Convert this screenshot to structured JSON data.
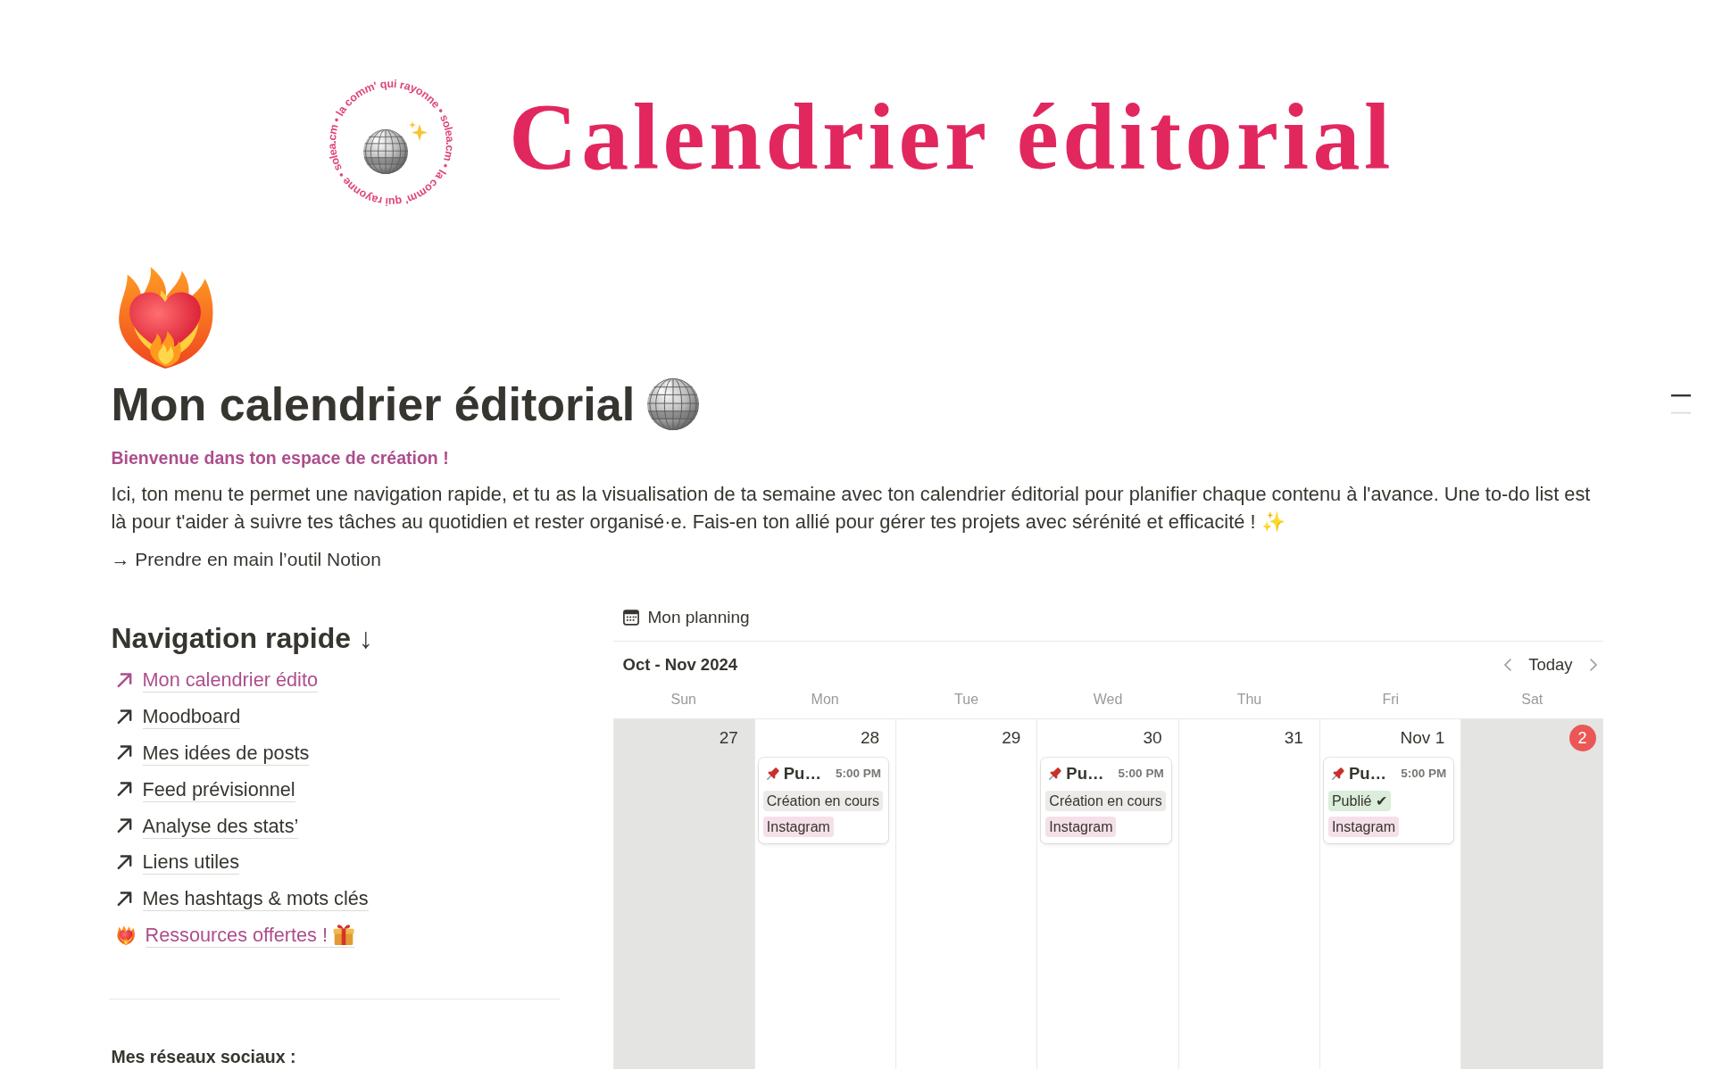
{
  "banner": {
    "logo_ring": [
      "la comm' qui rayonne •",
      "solea.cm •",
      "la comm' qui rayonne •",
      "solea.cm •"
    ],
    "title": "Calendrier éditorial"
  },
  "page": {
    "title": "Mon calendrier éditorial",
    "subtitle": "Bienvenue dans ton espace de création !",
    "intro": "Ici, ton menu te permet une navigation rapide, et tu as la visualisation de ta semaine avec ton calendrier éditorial pour planifier chaque contenu à l'avance. Une to-do list est là pour t'aider à suivre tes tâches au quotidien et rester organisé·e. Fais-en ton allié pour gérer tes projets avec sérénité et efficacité !",
    "intro_emoji": "✨",
    "guide": "→ Prendre en main l’outil Notion"
  },
  "navigation": {
    "heading": "Navigation rapide ↓",
    "items": [
      {
        "label": "Mon calendrier édito",
        "kind": "arrow",
        "color": "#ad4e8c"
      },
      {
        "label": "Moodboard",
        "kind": "arrow",
        "color": "#37352f"
      },
      {
        "label": "Mes idées de posts",
        "kind": "arrow",
        "color": "#37352f"
      },
      {
        "label": "Feed prévisionnel",
        "kind": "arrow",
        "color": "#37352f"
      },
      {
        "label": "Analyse des stats’",
        "kind": "arrow",
        "color": "#37352f"
      },
      {
        "label": "Liens utiles",
        "kind": "arrow",
        "color": "#37352f"
      },
      {
        "label": "Mes hashtags & mots clés",
        "kind": "arrow",
        "color": "#37352f"
      },
      {
        "label": "Ressources offertes !",
        "kind": "resource",
        "color": "#ad4e8c"
      }
    ]
  },
  "socials": {
    "heading": "Mes réseaux sociaux :"
  },
  "calendar": {
    "title": "Mon planning",
    "range": "Oct - Nov 2024",
    "today_button": "Today",
    "weekdays": [
      "Sun",
      "Mon",
      "Tue",
      "Wed",
      "Thu",
      "Fri",
      "Sat"
    ],
    "days": [
      {
        "label": "27",
        "weekend": true,
        "today": false
      },
      {
        "label": "28",
        "weekend": false,
        "today": false,
        "events": [
          {
            "title": "Pu…",
            "time": "5:00 PM",
            "tags": [
              {
                "label": "Création en cours",
                "color": "#ecebe9"
              },
              {
                "label": "Instagram",
                "color": "#f5e0ea"
              }
            ]
          }
        ]
      },
      {
        "label": "29",
        "weekend": false,
        "today": false
      },
      {
        "label": "30",
        "weekend": false,
        "today": false,
        "events": [
          {
            "title": "Pu…",
            "time": "5:00 PM",
            "tags": [
              {
                "label": "Création en cours",
                "color": "#ecebe9"
              },
              {
                "label": "Instagram",
                "color": "#f5e0ea"
              }
            ]
          }
        ]
      },
      {
        "label": "31",
        "weekend": false,
        "today": false
      },
      {
        "label": "Nov 1",
        "weekend": false,
        "today": false,
        "events": [
          {
            "title": "Pu…",
            "time": "5:00 PM",
            "tags": [
              {
                "label": "Publié ✔",
                "color": "#dbeddb"
              },
              {
                "label": "Instagram",
                "color": "#f5e0ea"
              }
            ]
          }
        ]
      },
      {
        "label": "2",
        "weekend": true,
        "today": true
      }
    ]
  }
}
